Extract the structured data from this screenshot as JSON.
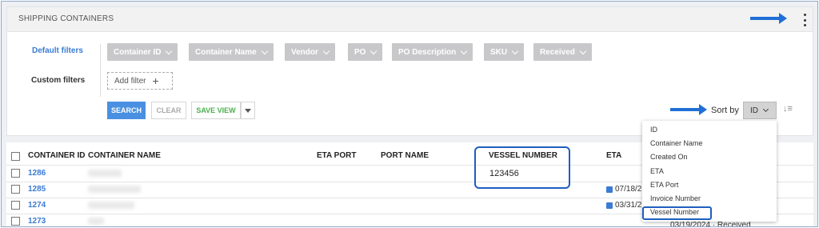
{
  "panel": {
    "title": "SHIPPING CONTAINERS"
  },
  "filters": {
    "default_label": "Default filters",
    "custom_label": "Custom filters",
    "chips": [
      "Container ID",
      "Container Name",
      "Vendor",
      "PO",
      "PO Description",
      "SKU",
      "Received"
    ],
    "add_filter": "Add filter",
    "add_icon": "plus-icon"
  },
  "actions": {
    "search": "SEARCH",
    "clear": "CLEAR",
    "save_view": "SAVE VIEW"
  },
  "sort": {
    "label": "Sort by",
    "value": "ID",
    "direction_icon": "sort-direction-icon",
    "options": [
      "ID",
      "Container Name",
      "Created On",
      "ETA",
      "ETA Port",
      "Invoice Number",
      "Vessel Number"
    ]
  },
  "table": {
    "columns": [
      "CONTAINER ID",
      "CONTAINER NAME",
      "ETA PORT",
      "PORT NAME",
      "VESSEL NUMBER",
      "ETA"
    ],
    "rows": [
      {
        "id": "1286",
        "vessel": "123456",
        "eta": ""
      },
      {
        "id": "1285",
        "vessel": "",
        "eta": "07/18/2"
      },
      {
        "id": "1274",
        "vessel": "",
        "eta": "03/31/2"
      },
      {
        "id": "1273",
        "vessel": "",
        "eta": "03/19/2024 · Received"
      }
    ]
  },
  "colors": {
    "accent": "#4a90e2",
    "link": "#3a7bd5",
    "save": "#4caf50",
    "annotation": "#1f5fbf"
  }
}
